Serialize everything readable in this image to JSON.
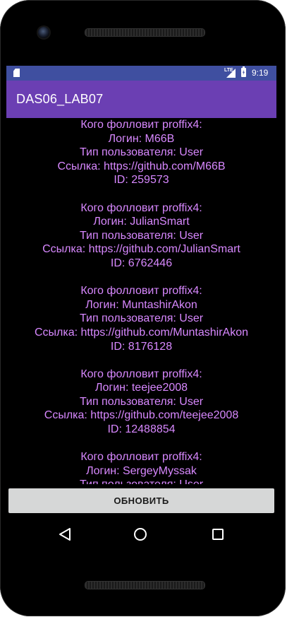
{
  "status_bar": {
    "network_label": "LTE",
    "time": "9:19"
  },
  "app_bar": {
    "title": "DAS06_LAB07"
  },
  "following": [
    {
      "header": "Кого фолловит proffix4:",
      "login": "Логин: M66B",
      "user_type": "Тип пользователя: User",
      "link": "Ссылка: https://github.com/M66B",
      "id": "ID: 259573"
    },
    {
      "header": "Кого фолловит proffix4:",
      "login": "Логин: JulianSmart",
      "user_type": "Тип пользователя: User",
      "link": "Ссылка: https://github.com/JulianSmart",
      "id": "ID: 6762446"
    },
    {
      "header": "Кого фолловит proffix4:",
      "login": "Логин: MuntashirAkon",
      "user_type": "Тип пользователя: User",
      "link": "Ссылка: https://github.com/MuntashirAkon",
      "id": "ID: 8176128"
    },
    {
      "header": "Кого фолловит proffix4:",
      "login": "Логин: teejee2008",
      "user_type": "Тип пользователя: User",
      "link": "Ссылка: https://github.com/teejee2008",
      "id": "ID: 12488854"
    },
    {
      "header": "Кого фолловит proffix4:",
      "login": "Логин: SergeyMyssak",
      "user_type": "Тип пользователя: User",
      "link": "",
      "id": ""
    }
  ],
  "refresh_button": {
    "label": "ОБНОВИТЬ"
  },
  "colors": {
    "status_bar": "#3f4fa0",
    "app_bar": "#6b3fb3",
    "list_text": "#d888ff",
    "button_bg": "#d6d7d7"
  },
  "icons": {
    "status_left": "sd-card-icon",
    "status_signal": "signal-icon",
    "status_battery": "battery-charging-icon",
    "nav_back": "back-icon",
    "nav_home": "home-icon",
    "nav_recents": "recents-icon"
  }
}
